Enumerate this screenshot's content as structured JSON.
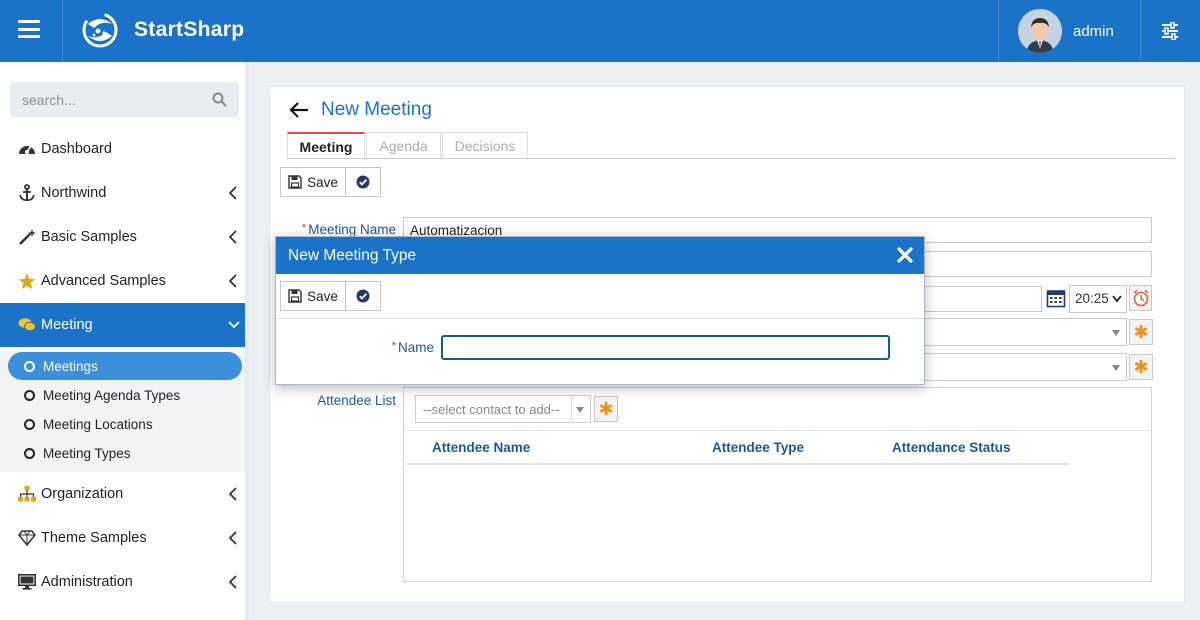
{
  "header": {
    "brand": "StartSharp",
    "username": "admin"
  },
  "sidebar": {
    "search_placeholder": "search...",
    "items": [
      {
        "label": "Dashboard",
        "icon": "dashboard-icon"
      },
      {
        "label": "Northwind",
        "icon": "anchor-icon"
      },
      {
        "label": "Basic Samples",
        "icon": "magic-wand-icon"
      },
      {
        "label": "Advanced Samples",
        "icon": "star-icon"
      },
      {
        "label": "Meeting",
        "icon": "comments-icon"
      },
      {
        "label": "Organization",
        "icon": "sitemap-icon"
      },
      {
        "label": "Theme Samples",
        "icon": "diamond-icon"
      },
      {
        "label": "Administration",
        "icon": "desktop-icon"
      }
    ],
    "meeting_sub": [
      "Meetings",
      "Meeting Agenda Types",
      "Meeting Locations",
      "Meeting Types"
    ]
  },
  "page": {
    "title": "New Meeting",
    "tabs": [
      "Meeting",
      "Agenda",
      "Decisions"
    ],
    "save_label": "Save",
    "meeting_name_label": "Meeting Name",
    "meeting_name_value": "Automatizacion",
    "time_value": "20:25",
    "attendee_list_label": "Attendee List",
    "contact_placeholder": "--select contact to add--",
    "grid_columns": [
      "Attendee Name",
      "Attendee Type",
      "Attendance Status"
    ]
  },
  "dialog": {
    "title": "New Meeting Type",
    "save_label": "Save",
    "name_label": "Name",
    "name_value": ""
  },
  "colors": {
    "primary": "#1a73c9",
    "required": "#d32f2f",
    "accent_star": "#f0901e"
  }
}
